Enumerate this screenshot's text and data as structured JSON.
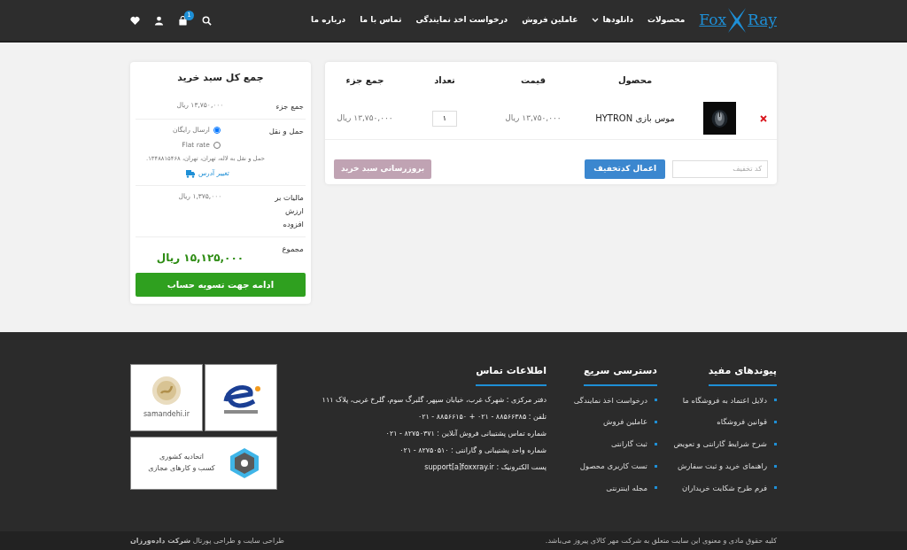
{
  "header": {
    "logo": {
      "left": "Fox",
      "right": "Ray"
    },
    "nav": [
      {
        "label": "محصولات",
        "dropdown": false
      },
      {
        "label": "دانلودها",
        "dropdown": true
      },
      {
        "label": "عاملین فروش",
        "dropdown": false
      },
      {
        "label": "درخواست اخذ نمایندگی",
        "dropdown": false
      },
      {
        "label": "تماس با ما",
        "dropdown": false
      },
      {
        "label": "درباره ما",
        "dropdown": false
      }
    ],
    "cart_count": "1"
  },
  "cart": {
    "columns": [
      "محصول",
      "قیمت",
      "تعداد",
      "جمع جزء"
    ],
    "rows": [
      {
        "product": "موس بازی HYTRON",
        "price": "۱۳,۷۵۰,۰۰۰ ریال",
        "quantity": "۱",
        "subtotal": "۱۳,۷۵۰,۰۰۰ ریال"
      }
    ],
    "coupon": {
      "placeholder": "کد تخفیف"
    },
    "apply_button": "اعمال کدتخفیف",
    "update_button": {
      "label": "بروزرسانی سبد خرید",
      "disabled": true
    }
  },
  "totals": {
    "title": "جمع کل سبد خرید",
    "subtotal": {
      "label": "جمع جزء",
      "value": "۱۳,۷۵۰,۰۰۰ ریال"
    },
    "shipping": {
      "label": "حمل و نقل",
      "options": [
        {
          "label": "ارسال رایگان",
          "selected": true
        },
        {
          "label": "Flat rate",
          "selected": false
        }
      ],
      "destination": "حمل و نقل به لاله، تهران، تهران، ۱۳۴۸۸۱۵۴۶۸.",
      "change_address": "تغییر آدرس"
    },
    "tax": {
      "label": "مالیات بر ارزش افزوده",
      "value": "۱,۳۷۵,۰۰۰ ریال"
    },
    "total": {
      "label": "مجموع",
      "value": "۱۵,۱۲۵,۰۰۰ ریال"
    },
    "checkout_button": "ادامه جهت تسویه حساب"
  },
  "footer": {
    "useful_links": {
      "title": "پیوندهای مفید",
      "items": [
        "دلایل اعتماد به فروشگاه ما",
        "قوانین فروشگاه",
        "شرح شرایط گارانتی و تعویض",
        "راهنمای خرید و ثبت سفارش",
        "فرم طرح شکایت خریداران"
      ]
    },
    "quick_access": {
      "title": "دسترسی سریع",
      "items": [
        "درخواست اخذ نمایندگی",
        "عاملین فروش",
        "ثبت گارانتی",
        "تست کاربری محصول",
        "مجله اینترنتی"
      ]
    },
    "contact": {
      "title": "اطلاعات تماس",
      "lines": [
        "دفتر مرکزی : شهرک غرب، خیابان سپهر، گلبرگ سوم، گلرخ غربی، پلاک ۱۱۱",
        "تلفن : ۸۸۵۶۶۳۸۵ - ۰۲۱ + ۸۸۵۶۶۱۵۰ - ۰۲۱",
        "شماره تماس پشتیبانی فروش آنلاین : ۸۲۷۵۰۳۷۱ - ۰۲۱",
        "شماره واحد پشتیبانی و گارانتی : ۸۲۷۵۰۵۱۰ - ۰۲۱",
        "پست الکترونیک : support[a]foxxray.ir"
      ]
    },
    "badges": {
      "samandehi": "samandehi.ir",
      "union": [
        "اتحادیه کشوری",
        "کسب و کارهای مجازی"
      ]
    },
    "copyright": "کلیه حقوق مادی و معنوی این سایت متعلق به شرکت مهر کالای پیروز می‌باشد.",
    "credit": "طراحی سایت و طراحی پورتال **شرکت داده‌ورزان**"
  }
}
